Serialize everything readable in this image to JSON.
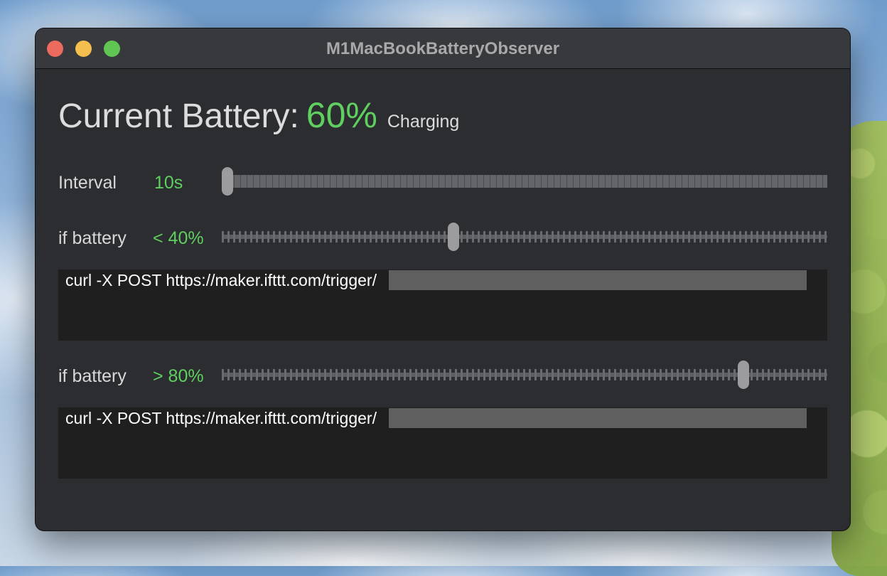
{
  "window": {
    "title": "M1MacBookBatteryObserver"
  },
  "battery": {
    "label": "Current Battery:",
    "value": "60%",
    "status": "Charging",
    "accent_color": "#5fcf5f"
  },
  "interval": {
    "label": "Interval",
    "value": "10s",
    "slider_fraction": 0.0
  },
  "low_trigger": {
    "label": "if battery",
    "value": "< 40%",
    "slider_fraction": 0.38,
    "command": "curl -X POST https://maker.ifttt.com/trigger/"
  },
  "high_trigger": {
    "label": "if battery",
    "value": "> 80%",
    "slider_fraction": 0.868,
    "command": "curl -X POST https://maker.ifttt.com/trigger/"
  }
}
